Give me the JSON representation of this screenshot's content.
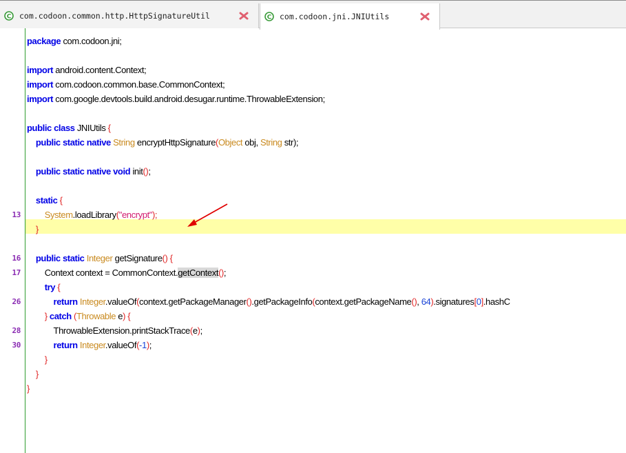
{
  "tabs": [
    {
      "label": "com.codoon.common.http.HttpSignatureUtil",
      "active": false,
      "icon": "class-icon",
      "close_icon": "close-icon"
    },
    {
      "label": "com.codoon.jni.JNIUtils",
      "active": true,
      "icon": "class-icon",
      "close_icon": "close-icon"
    }
  ],
  "colors": {
    "keyword": "#0000e6",
    "type": "#c98a1f",
    "punctuation": "#e02424",
    "string": "#d11a6e",
    "number": "#1a44d6",
    "line_number": "#8b2db3",
    "highlight": "#ffffa8",
    "gutter_line": "#2e9c2e",
    "annotation_arrow": "#e00000"
  },
  "editor": {
    "highlighted_line_number": "13",
    "lines": [
      {
        "num": "",
        "tokens": [
          {
            "t": "package",
            "c": "kw"
          },
          {
            "t": " com.codoon.jni;",
            "c": "pl"
          }
        ]
      },
      {
        "num": "",
        "tokens": []
      },
      {
        "num": "",
        "tokens": [
          {
            "t": "import",
            "c": "kw"
          },
          {
            "t": " android.content.Context;",
            "c": "pl"
          }
        ]
      },
      {
        "num": "",
        "tokens": [
          {
            "t": "import",
            "c": "kw"
          },
          {
            "t": " com.codoon.common.base.CommonContext;",
            "c": "pl"
          }
        ]
      },
      {
        "num": "",
        "tokens": [
          {
            "t": "import",
            "c": "kw"
          },
          {
            "t": " com.google.devtools.build.android.desugar.runtime.ThrowableExtension;",
            "c": "pl"
          }
        ]
      },
      {
        "num": "",
        "tokens": []
      },
      {
        "num": "",
        "tokens": [
          {
            "t": "public class",
            "c": "kw"
          },
          {
            "t": " JNIUtils ",
            "c": "pl"
          },
          {
            "t": "{",
            "c": "pn"
          }
        ]
      },
      {
        "num": "",
        "tokens": [
          {
            "t": "    ",
            "c": "pl"
          },
          {
            "t": "public static native",
            "c": "kw"
          },
          {
            "t": " String",
            "c": "ty"
          },
          {
            "t": " encryptHttpSignature",
            "c": "pl"
          },
          {
            "t": "(",
            "c": "pn"
          },
          {
            "t": "Object",
            "c": "ty"
          },
          {
            "t": " obj, ",
            "c": "pl"
          },
          {
            "t": "String",
            "c": "ty"
          },
          {
            "t": " str",
            "c": "pl"
          },
          {
            "t": ");",
            "c": "pl"
          }
        ]
      },
      {
        "num": "",
        "tokens": []
      },
      {
        "num": "",
        "tokens": [
          {
            "t": "    ",
            "c": "pl"
          },
          {
            "t": "public static native void",
            "c": "kw"
          },
          {
            "t": " init",
            "c": "pl"
          },
          {
            "t": "()",
            "c": "pn"
          },
          {
            "t": ";",
            "c": "pl"
          }
        ]
      },
      {
        "num": "",
        "tokens": []
      },
      {
        "num": "",
        "tokens": [
          {
            "t": "    ",
            "c": "pl"
          },
          {
            "t": "static",
            "c": "kw"
          },
          {
            "t": " {",
            "c": "pn"
          }
        ]
      },
      {
        "num": "13",
        "tokens": [
          {
            "t": "        ",
            "c": "pl"
          },
          {
            "t": "System",
            "c": "ty"
          },
          {
            "t": ".loadLibrary",
            "c": "pl"
          },
          {
            "t": "(",
            "c": "pn"
          },
          {
            "t": "\"encrypt\"",
            "c": "st"
          },
          {
            "t": ");",
            "c": "pn"
          }
        ]
      },
      {
        "num": "",
        "tokens": [
          {
            "t": "    ",
            "c": "pl"
          },
          {
            "t": "}",
            "c": "pn"
          }
        ]
      },
      {
        "num": "",
        "tokens": []
      },
      {
        "num": "16",
        "tokens": [
          {
            "t": "    ",
            "c": "pl"
          },
          {
            "t": "public static",
            "c": "kw"
          },
          {
            "t": " Integer",
            "c": "ty"
          },
          {
            "t": " getSignature",
            "c": "pl"
          },
          {
            "t": "()",
            "c": "pn"
          },
          {
            "t": " {",
            "c": "pn"
          }
        ]
      },
      {
        "num": "17",
        "tokens": [
          {
            "t": "        Context context = CommonContext.",
            "c": "pl"
          },
          {
            "t": "getContext",
            "c": "pl sel"
          },
          {
            "t": "()",
            "c": "pn"
          },
          {
            "t": ";",
            "c": "pl"
          }
        ]
      },
      {
        "num": "",
        "tokens": [
          {
            "t": "        ",
            "c": "pl"
          },
          {
            "t": "try",
            "c": "kw"
          },
          {
            "t": " {",
            "c": "pn"
          }
        ]
      },
      {
        "num": "26",
        "tokens": [
          {
            "t": "            ",
            "c": "pl"
          },
          {
            "t": "return",
            "c": "kw"
          },
          {
            "t": " Integer",
            "c": "ty"
          },
          {
            "t": ".valueOf",
            "c": "pl"
          },
          {
            "t": "(",
            "c": "pn"
          },
          {
            "t": "context.getPackageManager",
            "c": "pl"
          },
          {
            "t": "()",
            "c": "pn"
          },
          {
            "t": ".getPackageInfo",
            "c": "pl"
          },
          {
            "t": "(",
            "c": "pn"
          },
          {
            "t": "context.getPackageName",
            "c": "pl"
          },
          {
            "t": "()",
            "c": "pn"
          },
          {
            "t": ", ",
            "c": "pl"
          },
          {
            "t": "64",
            "c": "nm"
          },
          {
            "t": ")",
            "c": "pn"
          },
          {
            "t": ".signatures",
            "c": "pl"
          },
          {
            "t": "[",
            "c": "pn"
          },
          {
            "t": "0",
            "c": "nm"
          },
          {
            "t": "]",
            "c": "pn"
          },
          {
            "t": ".hashC",
            "c": "pl"
          }
        ]
      },
      {
        "num": "",
        "tokens": [
          {
            "t": "        ",
            "c": "pl"
          },
          {
            "t": "}",
            "c": "pn"
          },
          {
            "t": " catch",
            "c": "kw"
          },
          {
            "t": " (",
            "c": "pn"
          },
          {
            "t": "Throwable",
            "c": "ty"
          },
          {
            "t": " e",
            "c": "pl"
          },
          {
            "t": ")",
            "c": "pn"
          },
          {
            "t": " {",
            "c": "pn"
          }
        ]
      },
      {
        "num": "28",
        "tokens": [
          {
            "t": "            ThrowableExtension.printStackTrace",
            "c": "pl"
          },
          {
            "t": "(",
            "c": "pn"
          },
          {
            "t": "e",
            "c": "pl"
          },
          {
            "t": ")",
            "c": "pn"
          },
          {
            "t": ";",
            "c": "pl"
          }
        ]
      },
      {
        "num": "30",
        "tokens": [
          {
            "t": "            ",
            "c": "pl"
          },
          {
            "t": "return",
            "c": "kw"
          },
          {
            "t": " Integer",
            "c": "ty"
          },
          {
            "t": ".valueOf",
            "c": "pl"
          },
          {
            "t": "(",
            "c": "pn"
          },
          {
            "t": "-1",
            "c": "nm"
          },
          {
            "t": ")",
            "c": "pn"
          },
          {
            "t": ";",
            "c": "pl"
          }
        ]
      },
      {
        "num": "",
        "tokens": [
          {
            "t": "        ",
            "c": "pl"
          },
          {
            "t": "}",
            "c": "pn"
          }
        ]
      },
      {
        "num": "",
        "tokens": [
          {
            "t": "    ",
            "c": "pl"
          },
          {
            "t": "}",
            "c": "pn"
          }
        ]
      },
      {
        "num": "",
        "tokens": [
          {
            "t": "}",
            "c": "pn"
          }
        ]
      }
    ]
  }
}
